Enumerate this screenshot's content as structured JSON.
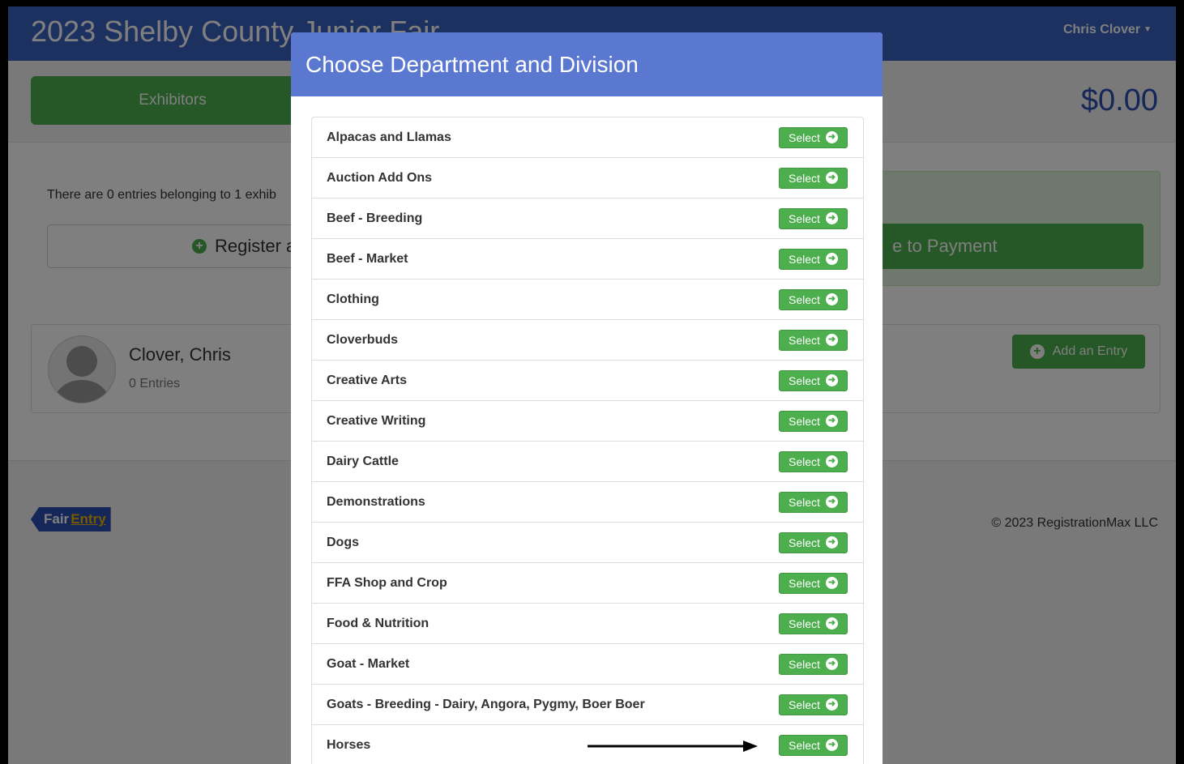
{
  "navbar": {
    "title": "2023 Shelby County Junior Fair",
    "user": "Chris Clover"
  },
  "subnav": {
    "exhibitors_tab": "Exhibitors",
    "cart_total": "$0.00"
  },
  "summary": {
    "info_text": "There are 0 entries belonging to 1 exhib",
    "register_label": "Register a",
    "payment_label": "e to Payment"
  },
  "exhibitor": {
    "name": "Clover, Chris",
    "entries": "0 Entries",
    "add_entry_label": "Add an Entry"
  },
  "footer": {
    "logo_fair": "Fair",
    "logo_entry": "Entry",
    "copyright": "© 2023 RegistrationMax LLC"
  },
  "modal": {
    "title": "Choose Department and Division",
    "select_label": "Select",
    "departments": [
      "Alpacas and Llamas",
      "Auction Add Ons",
      "Beef - Breeding",
      "Beef - Market",
      "Clothing",
      "Cloverbuds",
      "Creative Arts",
      "Creative Writing",
      "Dairy Cattle",
      "Demonstrations",
      "Dogs",
      "FFA Shop and Crop",
      "Food & Nutrition",
      "Goat - Market",
      "Goats - Breeding - Dairy, Angora, Pygmy, Boer Boer",
      "Horses"
    ],
    "highlighted_row": "Horses"
  },
  "colors": {
    "navbar": "#3a62c0",
    "modal_header": "#5a78d0",
    "button_green": "#4cae4c",
    "total_blue": "#2a4db0"
  }
}
